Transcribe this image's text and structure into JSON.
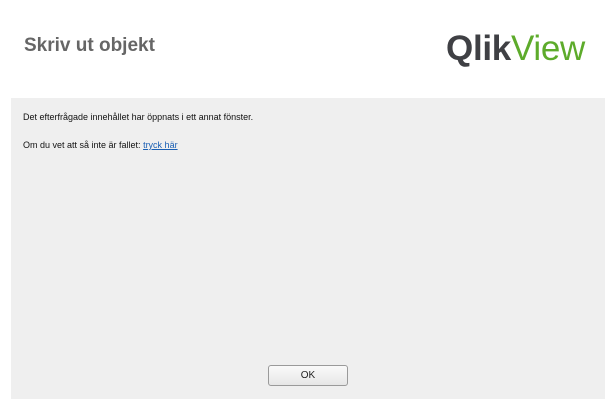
{
  "corner_mark": "·",
  "dialog": {
    "title": "Skriv ut objekt",
    "logo": {
      "part1": "Qlik",
      "part2": "View",
      "colors": {
        "qlik": "#3f4044",
        "view": "#5dab2b"
      }
    },
    "message_line1": "Det efterfrågade innehållet har öppnats i ett annat fönster.",
    "message_line2_prefix": "Om du vet att så inte är fallet: ",
    "link_label": "tryck här",
    "ok_label": "OK"
  }
}
